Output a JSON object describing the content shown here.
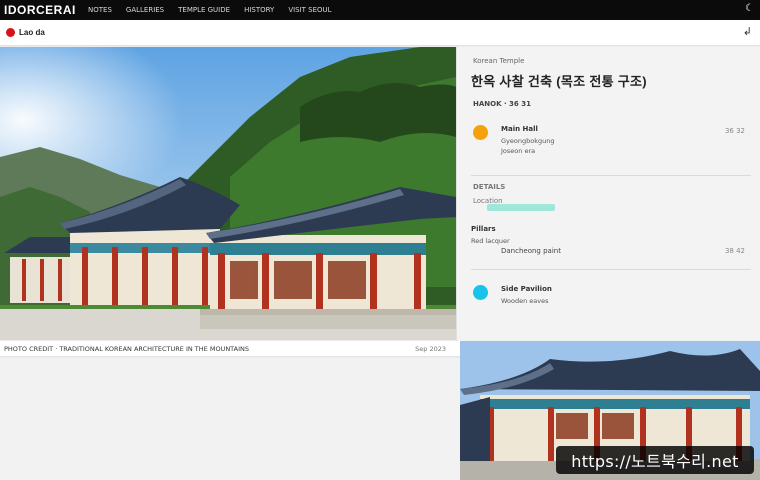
{
  "app": {
    "brand": "IDORCERAI",
    "nav": [
      "NOTES",
      "GALLERIES",
      "TEMPLE GUIDE",
      "HISTORY",
      "VISIT SEOUL"
    ]
  },
  "subbar": {
    "site_label": "Lao da",
    "arrow": "↲"
  },
  "sidepanel": {
    "tag": "Korean Temple",
    "title": "한옥 사찰 건축 (목조 전통 구조)",
    "subtitle": "HANOK · 36 31",
    "items": [
      {
        "color": "#f4a20b",
        "title": "Main Hall",
        "line2": "Gyeongbokgung",
        "line3": "Joseon era",
        "right": "36 32"
      },
      {
        "color": "#19c2e8",
        "title": "Side Pavilion",
        "line2": "Wooden eaves",
        "line3": "",
        "right": ""
      }
    ],
    "section_label": "DETAILS",
    "section_sub": "Location",
    "row": {
      "t1": "Pillars",
      "t2": "Red lacquer",
      "t3": "Dancheong paint",
      "right": "38 42"
    }
  },
  "caption": {
    "left": "PHOTO CREDIT · TRADITIONAL KOREAN ARCHITECTURE IN THE MOUNTAINS",
    "right": "Sep 2023"
  },
  "watermark": "https://노트북수리.net",
  "colors": {
    "topbar": "#0b0b0b",
    "accent_red": "#d7141a",
    "accent_orange": "#f4a20b",
    "accent_cyan": "#19c2e8",
    "roof": "#2d3b52",
    "pillar": "#b1321f"
  }
}
